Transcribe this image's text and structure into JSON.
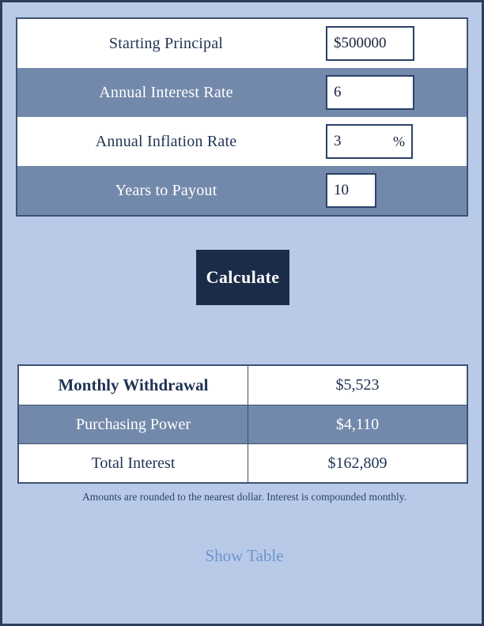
{
  "theme": {
    "page_background": "#b8cae8",
    "page_border": "#2b3f5c",
    "row_shade": "#7389ab",
    "row_light": "#ffffff",
    "text_dark": "#1f3354",
    "text_light": "#ffffff",
    "button_background": "#1b2c49",
    "link_color": "#6e93cf",
    "field_border": "#2b4168"
  },
  "inputs": {
    "rows": [
      {
        "label": "Starting Principal",
        "value": "$500000",
        "suffix": "",
        "placeholder": "$0",
        "field_width": "wide",
        "shaded": false,
        "name": "starting-principal"
      },
      {
        "label": "Annual Interest Rate",
        "value": "6",
        "suffix": "",
        "placeholder": "0",
        "field_width": "wide",
        "shaded": true,
        "name": "annual-interest-rate"
      },
      {
        "label": "Annual Inflation Rate",
        "value": "3",
        "suffix": "%",
        "placeholder": "0",
        "field_width": "medium",
        "shaded": false,
        "name": "annual-inflation-rate"
      },
      {
        "label": "Years to Payout",
        "value": "10",
        "suffix": "",
        "placeholder": "0",
        "field_width": "narrow",
        "shaded": true,
        "name": "years-to-payout"
      }
    ]
  },
  "actions": {
    "calculate_label": "Calculate",
    "show_table_label": "Show Table"
  },
  "results": {
    "rows": [
      {
        "label": "Monthly Withdrawal",
        "value": "$5,523",
        "shaded": false,
        "name": "monthly-withdrawal"
      },
      {
        "label": "Purchasing Power",
        "value": "$4,110",
        "shaded": true,
        "name": "purchasing-power"
      },
      {
        "label": "Total Interest",
        "value": "$162,809",
        "shaded": false,
        "name": "total-interest"
      }
    ]
  },
  "footnote": "Amounts are rounded to the nearest dollar. Interest is compounded monthly."
}
